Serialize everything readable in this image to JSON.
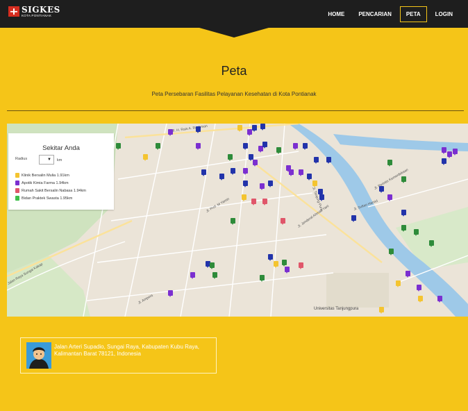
{
  "brand": {
    "name": "SIGKES",
    "subtitle": "KOTA PONTIANAK"
  },
  "nav": {
    "items": [
      {
        "label": "HOME",
        "active": false
      },
      {
        "label": "PENCARIAN",
        "active": false
      },
      {
        "label": "PETA",
        "active": true
      },
      {
        "label": "LOGIN",
        "active": false
      }
    ]
  },
  "header": {
    "title": "Peta",
    "subtitle": "Peta Persebaran Fasilitas Pelayanan Kesehatan di Kota Pontianak"
  },
  "panel": {
    "title": "Sekitar Anda",
    "radius_label": "Radius",
    "radius_value": "▼",
    "radius_unit": "km",
    "nearby": [
      {
        "label": "Klinik Bersalin Mulia 1.91km",
        "color": "#f4c430"
      },
      {
        "label": "Apotik Kimia Farma 1.94km",
        "color": "#7b2fd0"
      },
      {
        "label": "Rumah Sakit Bersalin Nabasa 1.94km",
        "color": "#e0566a"
      },
      {
        "label": "Bidan Praktek Swasta 1.95km",
        "color": "#3fbf4a"
      }
    ]
  },
  "map": {
    "labels": {
      "l1": "Universitas Tanjungpura",
      "l2": "Jl. Jenderal Ahmad Yani",
      "l3": "Jl. H. Rais A. Rachman",
      "l4": "Jl. Tanjung Pura",
      "l5": "Jl. Sultan Hamid",
      "l6": "Jalan Raya Sungai Kakap",
      "l7": "Jl. Prof. M Yamin",
      "l8": "Jl. Perintis Kemerdekaan",
      "l9": "Jl. Ampera"
    },
    "marker_colors": {
      "blue": "#2233aa",
      "purple": "#7b2fd0",
      "green": "#2e8b3a",
      "red": "#e0566a",
      "yellow": "#f4c430"
    }
  },
  "address": {
    "text": "Jalan Arteri Supadio, Sungai Raya, Kabupaten Kubu Raya, Kalimantan Barat 78121, Indonesia"
  }
}
